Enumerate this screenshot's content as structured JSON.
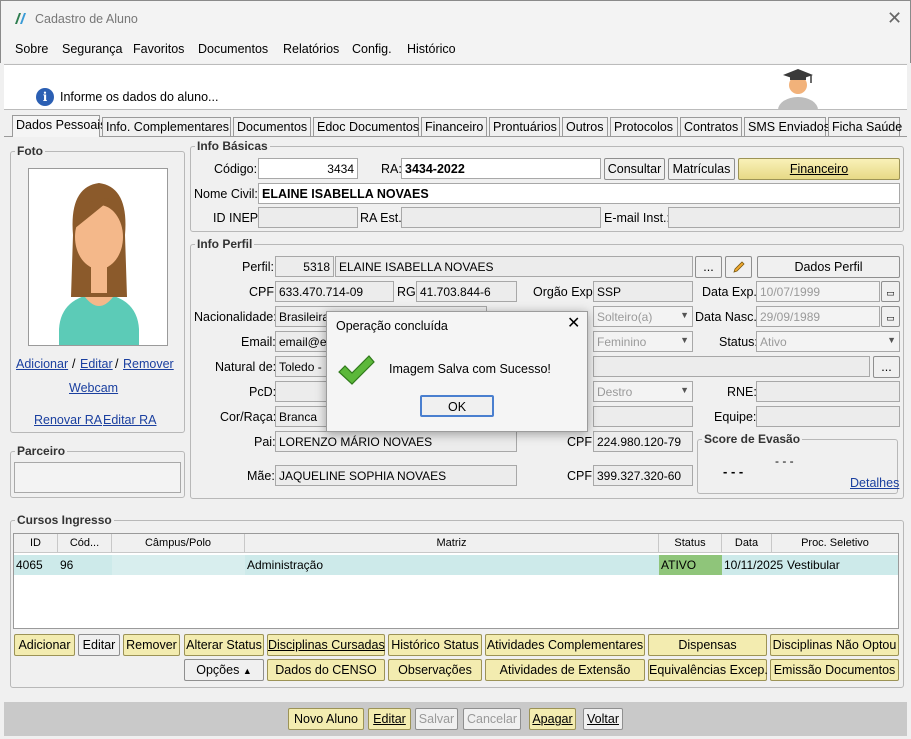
{
  "window": {
    "title": "Cadastro de Aluno"
  },
  "menu": [
    "Sobre",
    "Segurança",
    "Favoritos",
    "Documentos",
    "Relatórios",
    "Config.",
    "Histórico"
  ],
  "banner": {
    "message": "Informe os dados do aluno..."
  },
  "tabs": [
    "Dados Pessoais",
    "Info. Complementares",
    "Documentos",
    "Edoc Documentos",
    "Financeiro",
    "Prontuários",
    "Outros",
    "Protocolos",
    "Contratos",
    "SMS Enviados",
    "Ficha Saúde"
  ],
  "foto": {
    "title": "Foto",
    "add": "Adicionar",
    "edit": "Editar",
    "remove": "Remover",
    "sep": "/",
    "webcam": "Webcam",
    "renew": "Renovar RA",
    "edit_ra": "Editar RA"
  },
  "parceiro": {
    "title": "Parceiro"
  },
  "info_basicas": {
    "title": "Info Básicas",
    "codigo_label": "Código:",
    "codigo": "3434",
    "ra_label": "RA:",
    "ra": "3434-2022",
    "consultar": "Consultar",
    "matriculas": "Matrículas",
    "financeiro": "Financeiro",
    "nome_label": "Nome Civil:",
    "nome": "ELAINE ISABELLA NOVAES",
    "inep_label": "ID INEP:",
    "ra_est_label": "RA Est.:",
    "email_inst_label": "E-mail Inst.:"
  },
  "info_perfil": {
    "title": "Info Perfil",
    "perfil_label": "Perfil:",
    "perfil_id": "5318",
    "perfil_nome": "ELAINE ISABELLA NOVAES",
    "dots": "...",
    "dados_perfil": "Dados Perfil",
    "cpf_label": "CPF:",
    "cpf": "633.470.714-09",
    "rg_label": "RG:",
    "rg": "41.703.844-6",
    "orgao_label": "Orgão Exp:",
    "orgao": "SSP",
    "data_exp_label": "Data Exp.:",
    "data_exp": "10/07/1999",
    "nac_label": "Nacionalidade:",
    "nac": "Brasileira",
    "estado_civil": "Solteiro(a)",
    "data_nasc_label": "Data Nasc.:",
    "data_nasc": "29/09/1989",
    "email_label": "Email:",
    "email": "email@er",
    "sexo": "Feminino",
    "status_label": "Status:",
    "status": "Ativo",
    "natural_label": "Natural de:",
    "natural": "Toledo -",
    "pcd_label": "PcD:",
    "lateralidade": "Destro",
    "rne_label": "RNE:",
    "cor_label": "Cor/Raça:",
    "cor": "Branca",
    "equipe_label": "Equipe:",
    "pai_label": "Pai:",
    "pai": "LORENZO MÁRIO NOVAES",
    "pai_cpf_label": "CPF:",
    "pai_cpf": "224.980.120-79",
    "mae_label": "Mãe:",
    "mae": "JAQUELINE SOPHIA NOVAES",
    "mae_cpf_label": "CPF:",
    "mae_cpf": "399.327.320-60"
  },
  "evasao": {
    "title": "Score de Evasão",
    "v1": "- - -",
    "v2": "- - -",
    "detalhes": "Detalhes"
  },
  "cursos": {
    "title": "Cursos Ingresso",
    "headers": [
      "ID",
      "Cód...",
      "Câmpus/Polo",
      "Matriz",
      "Status",
      "Data",
      "Proc. Seletivo"
    ],
    "rows": [
      {
        "id": "4065",
        "cod": "96",
        "campus": "",
        "matriz": "Administração",
        "status": "ATIVO",
        "data": "10/11/2025",
        "proc": "Vestibular"
      }
    ],
    "row1": [
      "Adicionar",
      "Editar",
      "Remover",
      "Alterar Status",
      "Disciplinas Cursadas",
      "Histórico Status",
      "Atividades Complementares",
      "Dispensas",
      "Disciplinas Não Optou"
    ],
    "opcoes": "Opções",
    "row2": [
      "Dados do CENSO",
      "Observações",
      "Atividades de Extensão",
      "Equivalências Excep.",
      "Emissão Documentos"
    ]
  },
  "footer": [
    "Novo Aluno",
    "Editar",
    "Salvar",
    "Cancelar",
    "Apagar",
    "Voltar"
  ],
  "dialog": {
    "title": "Operação concluída",
    "message": "Imagem Salva com Sucesso!",
    "ok": "OK"
  },
  "colors": {
    "accent_yellow": "#f3ecb0",
    "status_green": "#8fc57a",
    "row_highlight": "#cdeaea",
    "link": "#1a3f9f"
  }
}
